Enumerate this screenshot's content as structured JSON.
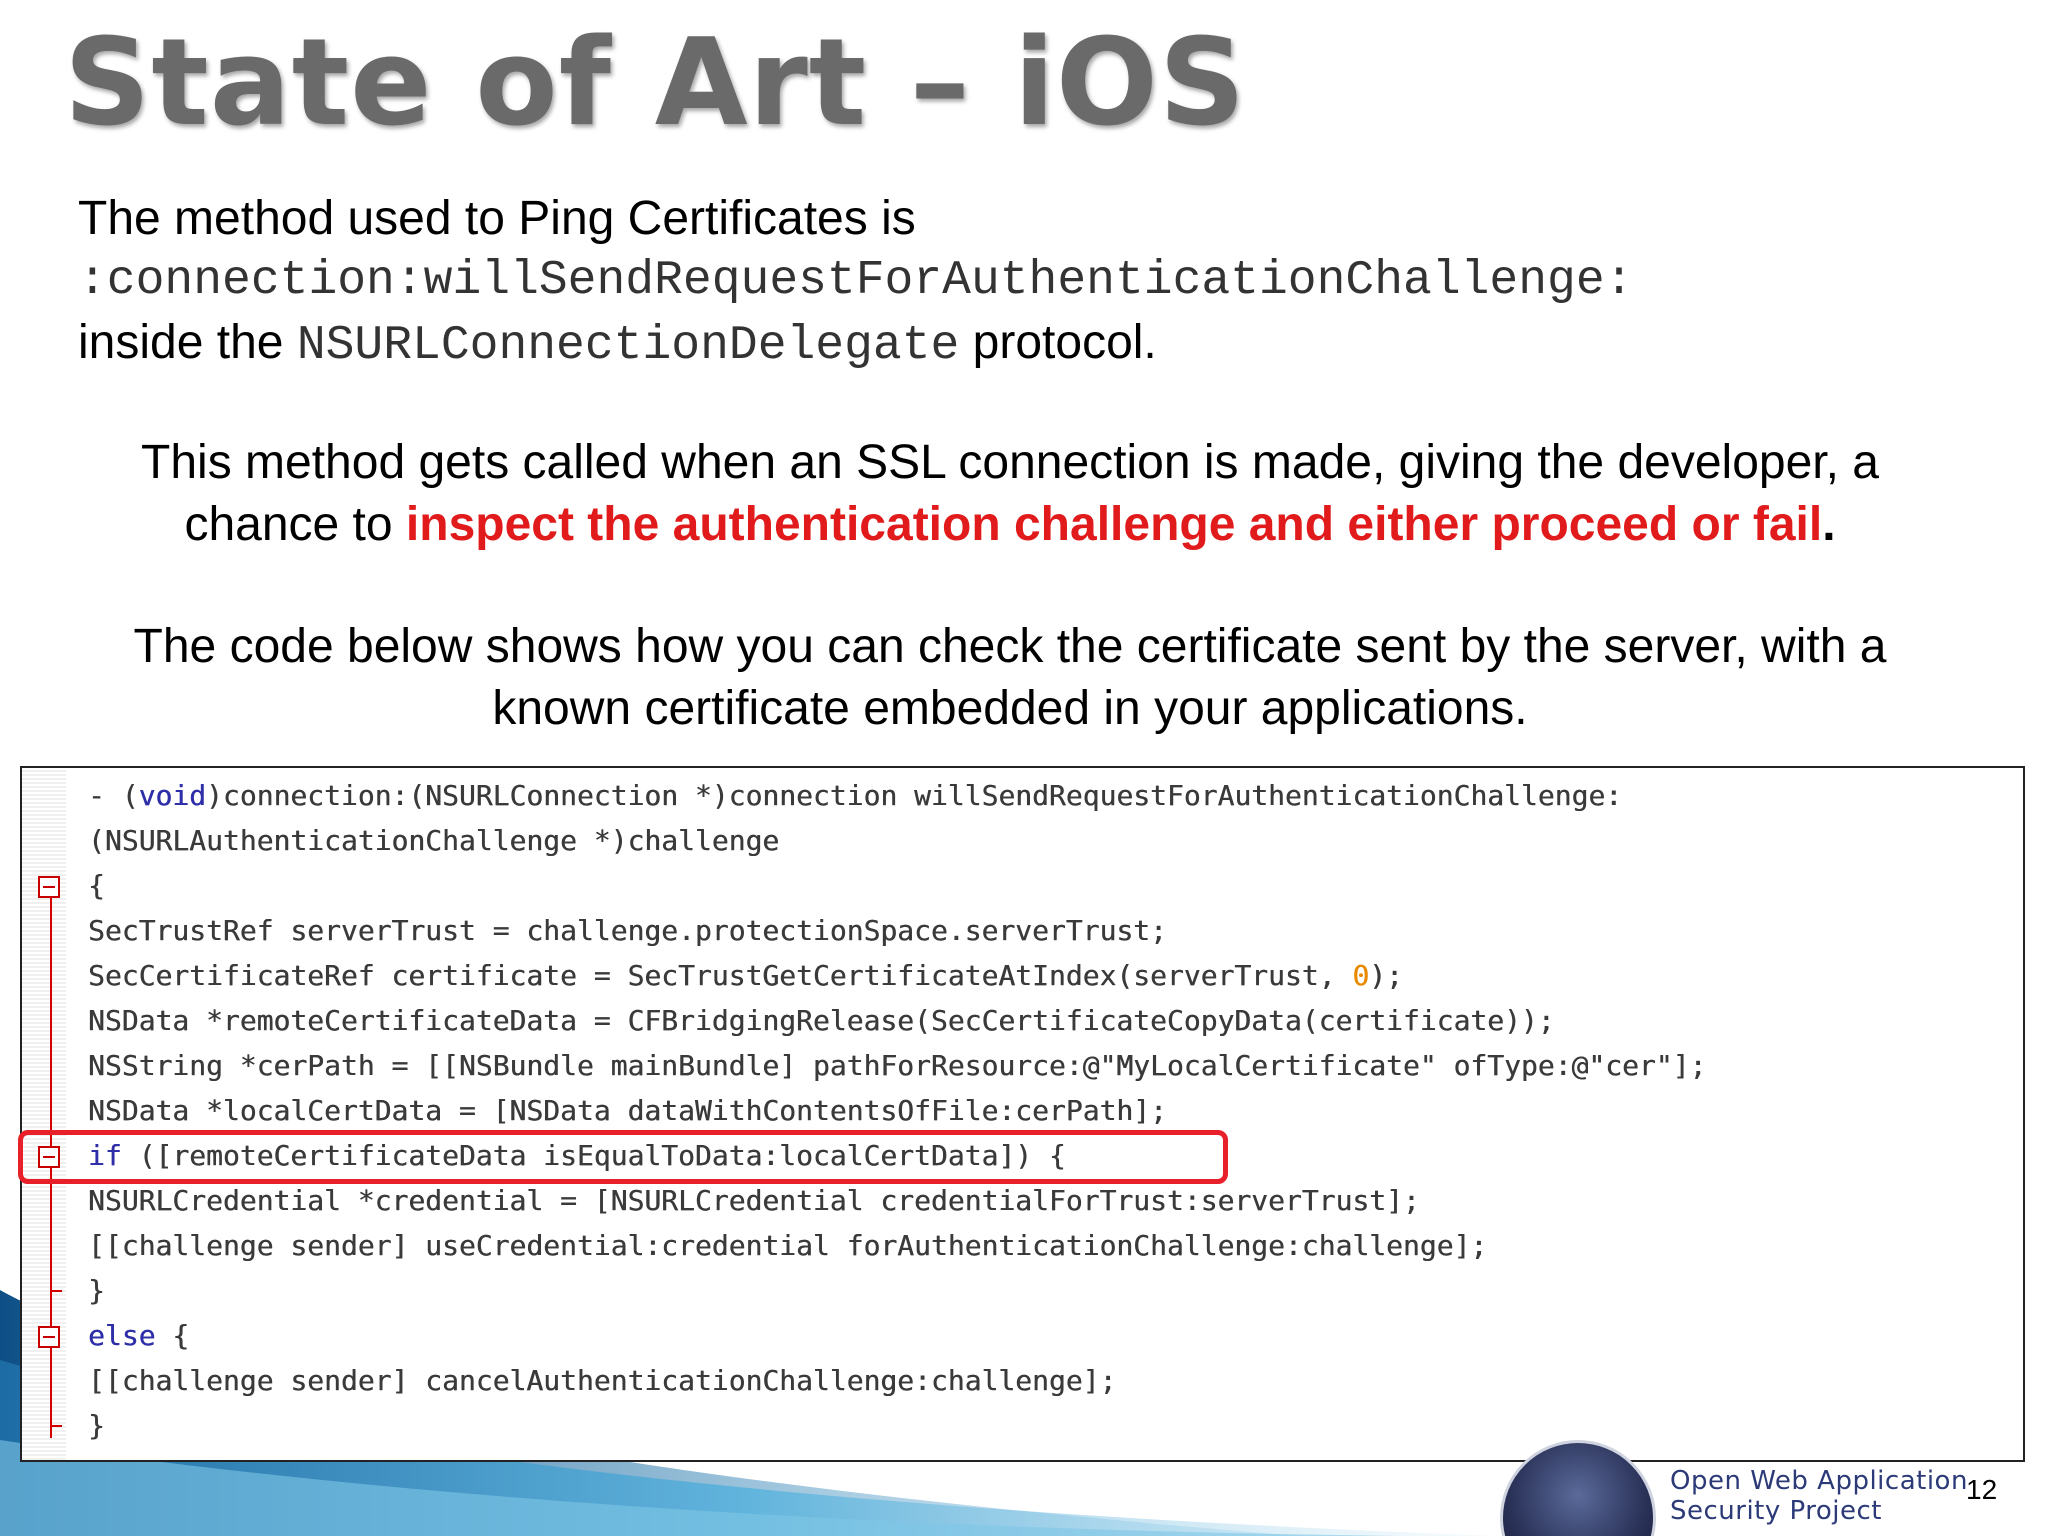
{
  "slide": {
    "title": "State of Art – iOS",
    "paragraph1": {
      "line1": "The method used to Ping Certificates is",
      "method_name": ":connection:willSendRequestForAuthenticationChallenge:",
      "prefix": "inside the ",
      "protocol_name": "NSURLConnectionDelegate",
      "suffix": " protocol."
    },
    "paragraph2": {
      "text": "This method gets called when an SSL connection is made, giving the developer, a chance to ",
      "highlight": "inspect the authentication challenge and either proceed or fail",
      "end": "."
    },
    "paragraph3": {
      "text": "The code below shows how you can check the certificate sent by the server, with a known certificate embedded in your applications."
    },
    "code": {
      "l1_a": "- (",
      "l1_kw": "void",
      "l1_b": ")connection:(NSURLConnection *)connection willSendRequestForAuthenticationChallenge:",
      "l2": "(NSURLAuthenticationChallenge *)challenge",
      "l3": "{",
      "l4": "SecTrustRef serverTrust = challenge.protectionSpace.serverTrust;",
      "l5_a": "SecCertificateRef certificate = SecTrustGetCertificateAtIndex(serverTrust, ",
      "l5_num": "0",
      "l5_b": ");",
      "l6": "NSData *remoteCertificateData = CFBridgingRelease(SecCertificateCopyData(certificate));",
      "l7": "NSString *cerPath = [[NSBundle mainBundle] pathForResource:@\"MyLocalCertificate\" ofType:@\"cer\"];",
      "l8": "NSData *localCertData = [NSData dataWithContentsOfFile:cerPath];",
      "l9_kw": "if",
      "l9_b": " ([remoteCertificateData isEqualToData:localCertData]) {",
      "l10": "NSURLCredential *credential = [NSURLCredential credentialForTrust:serverTrust];",
      "l11": "[[challenge sender] useCredential:credential forAuthenticationChallenge:challenge];",
      "l12": "}",
      "l13_kw": "else",
      "l13_b": " {",
      "l14": "[[challenge sender] cancelAuthenticationChallenge:challenge];",
      "l15": "}"
    },
    "footer": {
      "org_line1": "Open Web Application",
      "org_line2": "Security Project",
      "page_number": "12"
    },
    "colors": {
      "highlight": "#e11b1b",
      "keyword": "#2e2ea8",
      "number": "#e88a00",
      "code_box_highlight": "#e8202a"
    }
  }
}
